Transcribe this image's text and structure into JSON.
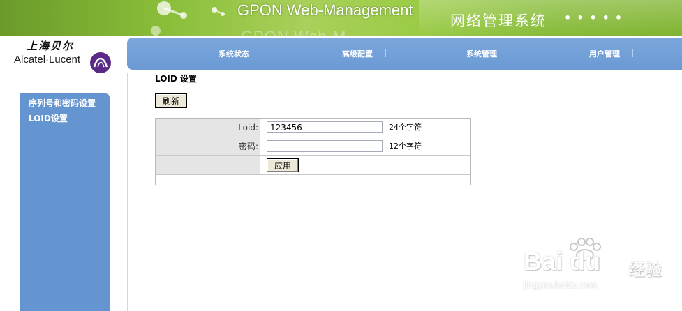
{
  "header": {
    "title": "GPON Web-Management",
    "title_ghost": "GPON Web-M",
    "system_name": "网络管理系统",
    "dots": "•••••"
  },
  "logo": {
    "cn": "上海贝尔",
    "en": "Alcatel·Lucent"
  },
  "nav": {
    "items": [
      {
        "label": "系统状态"
      },
      {
        "label": "高级配置"
      },
      {
        "label": "系统管理"
      },
      {
        "label": "用户管理"
      }
    ]
  },
  "sidebar": {
    "items": [
      {
        "label": "序列号和密码设置"
      },
      {
        "label": "LOID设置"
      }
    ]
  },
  "main": {
    "title": "LOID 设置",
    "refresh_label": "刷新",
    "form": {
      "loid_label": "Loid:",
      "loid_value": "123456",
      "loid_hint": "24个字符",
      "password_label": "密码:",
      "password_value": "",
      "password_hint": "12个字符",
      "apply_label": "应用"
    }
  },
  "watermark": {
    "brand": "Bai du",
    "site_cn": "经验",
    "url": "jingyan.baidu.com"
  }
}
